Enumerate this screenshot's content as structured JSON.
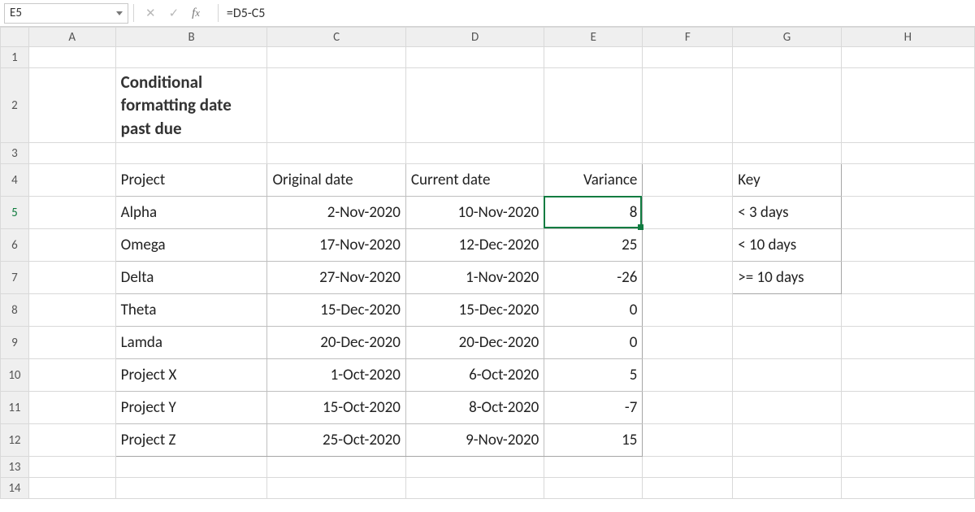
{
  "formula_bar": {
    "cell_ref": "E5",
    "formula": "=D5-C5"
  },
  "columns": [
    "A",
    "B",
    "C",
    "D",
    "E",
    "F",
    "G",
    "H"
  ],
  "rows": [
    "1",
    "2",
    "3",
    "4",
    "5",
    "6",
    "7",
    "8",
    "9",
    "10",
    "11",
    "12",
    "13",
    "14"
  ],
  "active": {
    "col": "E",
    "row": "5"
  },
  "title": "Conditional formatting date past due",
  "main_headers": {
    "project": "Project",
    "original": "Original date",
    "current": "Current date",
    "variance": "Variance"
  },
  "data": [
    {
      "project": "Alpha",
      "original": "2-Nov-2020",
      "current": "10-Nov-2020",
      "variance": "8",
      "fill": "yellow"
    },
    {
      "project": "Omega",
      "original": "17-Nov-2020",
      "current": "12-Dec-2020",
      "variance": "25",
      "fill": "orange"
    },
    {
      "project": "Delta",
      "original": "27-Nov-2020",
      "current": "1-Nov-2020",
      "variance": "-26",
      "fill": "green"
    },
    {
      "project": "Theta",
      "original": "15-Dec-2020",
      "current": "15-Dec-2020",
      "variance": "0",
      "fill": "green"
    },
    {
      "project": "Lamda",
      "original": "20-Dec-2020",
      "current": "20-Dec-2020",
      "variance": "0",
      "fill": "green"
    },
    {
      "project": "Project X",
      "original": "1-Oct-2020",
      "current": "6-Oct-2020",
      "variance": "5",
      "fill": "yellow"
    },
    {
      "project": "Project Y",
      "original": "15-Oct-2020",
      "current": "8-Oct-2020",
      "variance": "-7",
      "fill": "green"
    },
    {
      "project": "Project Z",
      "original": "25-Oct-2020",
      "current": "9-Nov-2020",
      "variance": "15",
      "fill": "orange"
    }
  ],
  "key": {
    "header": "Key",
    "items": [
      {
        "label": "< 3 days",
        "fill": "green"
      },
      {
        "label": "< 10 days",
        "fill": "yellow"
      },
      {
        "label": ">= 10 days",
        "fill": "orange"
      }
    ]
  }
}
